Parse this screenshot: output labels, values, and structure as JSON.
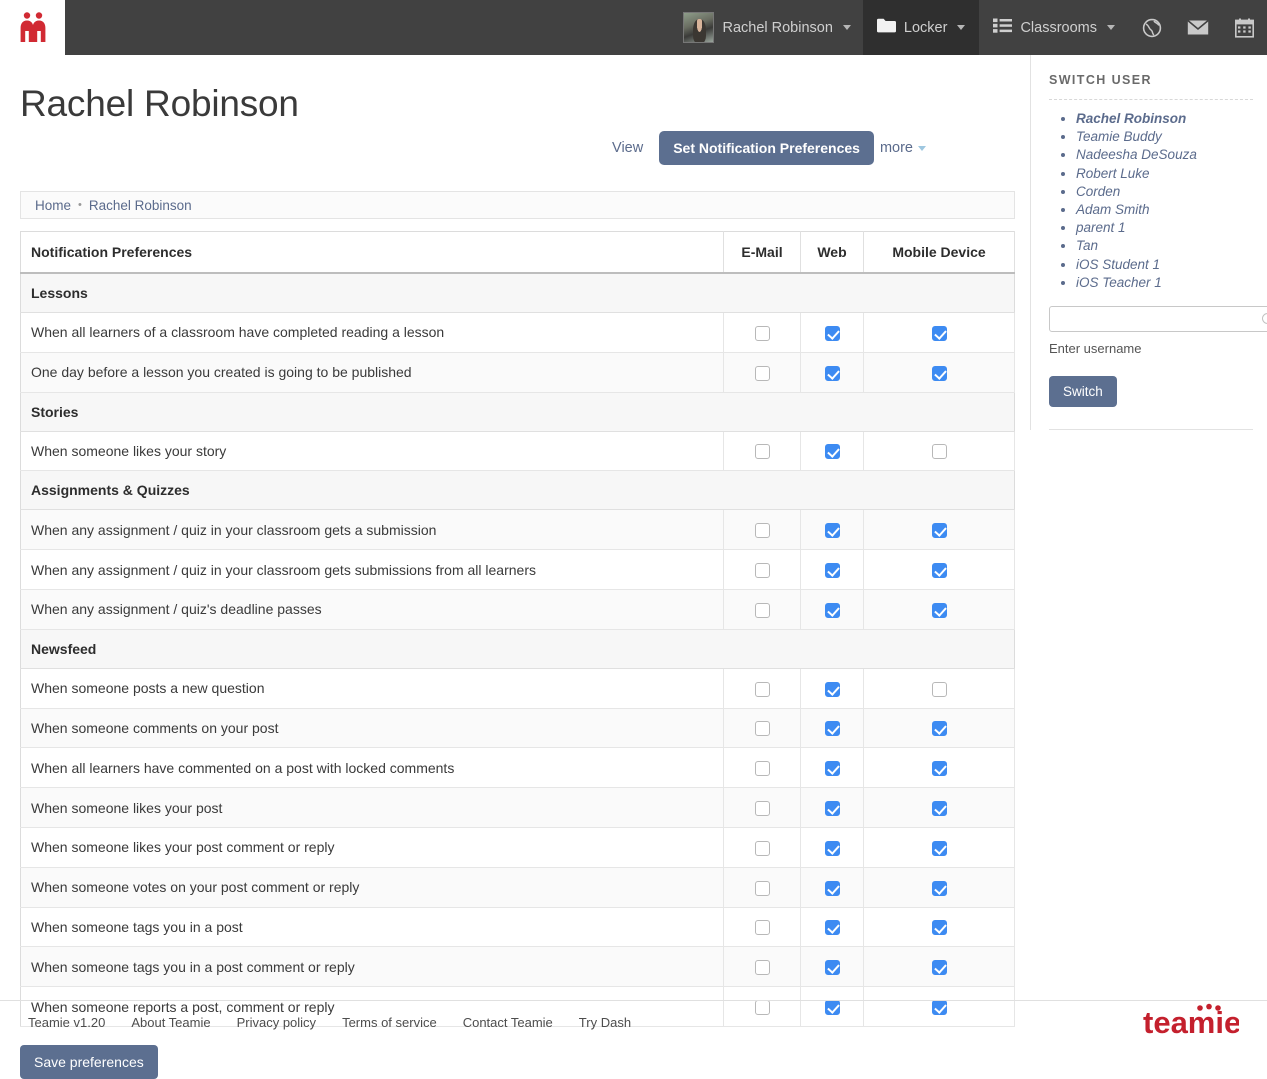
{
  "navbar": {
    "brand_icon": "teamie-people-logo",
    "user": {
      "name": "Rachel Robinson",
      "avatar": "user-avatar"
    },
    "items": [
      {
        "label": "Locker",
        "icon": "folder-icon",
        "active": true
      },
      {
        "label": "Classrooms",
        "icon": "list-icon",
        "active": false
      }
    ],
    "icons": [
      {
        "name": "globe-icon"
      },
      {
        "name": "envelope-icon"
      },
      {
        "name": "calendar-icon"
      }
    ]
  },
  "header": {
    "title": "Rachel Robinson",
    "tabs": {
      "view_label": "View",
      "active_label": "Set Notification Preferences",
      "more_label": "more"
    }
  },
  "breadcrumb": {
    "home": "Home",
    "separator": "•",
    "current": "Rachel Robinson"
  },
  "table": {
    "columns": [
      "Notification Preferences",
      "E-Mail",
      "Web",
      "Mobile Device"
    ],
    "groups": [
      {
        "name": "Lessons",
        "rows": [
          {
            "label": "When all learners of a classroom have completed reading a lesson",
            "email": false,
            "web": true,
            "mobile": true
          },
          {
            "label": "One day before a lesson you created is going to be published",
            "email": false,
            "web": true,
            "mobile": true
          }
        ]
      },
      {
        "name": "Stories",
        "rows": [
          {
            "label": "When someone likes your story",
            "email": false,
            "web": true,
            "mobile": false
          }
        ]
      },
      {
        "name": "Assignments & Quizzes",
        "rows": [
          {
            "label": "When any assignment / quiz in your classroom gets a submission",
            "email": false,
            "web": true,
            "mobile": true
          },
          {
            "label": "When any assignment / quiz in your classroom gets submissions from all learners",
            "email": false,
            "web": true,
            "mobile": true
          },
          {
            "label": "When any assignment / quiz's deadline passes",
            "email": false,
            "web": true,
            "mobile": true
          }
        ]
      },
      {
        "name": "Newsfeed",
        "rows": [
          {
            "label": "When someone posts a new question",
            "email": false,
            "web": true,
            "mobile": false
          },
          {
            "label": "When someone comments on your post",
            "email": false,
            "web": true,
            "mobile": true
          },
          {
            "label": "When all learners have commented on a post with locked comments",
            "email": false,
            "web": true,
            "mobile": true
          },
          {
            "label": "When someone likes your post",
            "email": false,
            "web": true,
            "mobile": true
          },
          {
            "label": "When someone likes your post comment or reply",
            "email": false,
            "web": true,
            "mobile": true
          },
          {
            "label": "When someone votes on your post comment or reply",
            "email": false,
            "web": true,
            "mobile": true
          },
          {
            "label": "When someone tags you in a post",
            "email": false,
            "web": true,
            "mobile": true
          },
          {
            "label": "When someone tags you in a post comment or reply",
            "email": false,
            "web": true,
            "mobile": true
          },
          {
            "label": "When someone reports a post, comment or reply",
            "email": false,
            "web": true,
            "mobile": true
          }
        ]
      }
    ]
  },
  "save_button": "Save preferences",
  "rail": {
    "title": "SWITCH USER",
    "users": [
      {
        "name": "Rachel Robinson",
        "current": true
      },
      {
        "name": "Teamie Buddy",
        "current": false
      },
      {
        "name": "Nadeesha DeSouza",
        "current": false
      },
      {
        "name": "Robert Luke",
        "current": false
      },
      {
        "name": "Corden",
        "current": false
      },
      {
        "name": "Adam Smith",
        "current": false
      },
      {
        "name": "parent 1",
        "current": false
      },
      {
        "name": "Tan",
        "current": false
      },
      {
        "name": "iOS Student 1",
        "current": false
      },
      {
        "name": "iOS Teacher 1",
        "current": false
      }
    ],
    "input_value": "",
    "input_placeholder": "",
    "help_text": "Enter username",
    "switch_button": "Switch"
  },
  "footer": {
    "links": [
      "Teamie v1.20",
      "About Teamie",
      "Privacy policy",
      "Terms of service",
      "Contact Teamie",
      "Try Dash"
    ],
    "logo_text": "teamie"
  },
  "colors": {
    "navbar_bg": "#414141",
    "navbar_active_bg": "#2f2f2f",
    "accent_button": "#5c6f90",
    "checkbox_on": "#3d8bf2",
    "brand_red": "#d12a33",
    "link": "#5b6b8c"
  }
}
